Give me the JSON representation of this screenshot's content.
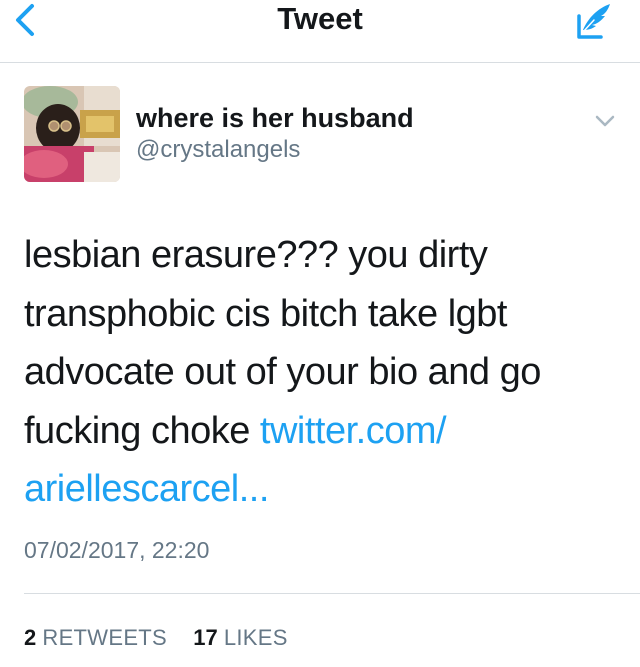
{
  "navbar": {
    "title": "Tweet",
    "back_icon": "chevron-left-icon",
    "compose_icon": "compose-feather-icon"
  },
  "tweet": {
    "author": {
      "display_name": "where is her husband",
      "handle": "@crystalangels"
    },
    "menu_icon": "chevron-down-icon",
    "text_lines": [
      {
        "text": "lesbian erasure??? you dirty",
        "link": ""
      },
      {
        "text": "transphobic cis bitch take lgbt",
        "link": ""
      },
      {
        "text": "advocate out of your bio and go",
        "link": ""
      },
      {
        "text": "fucking choke ",
        "link": "twitter.com/"
      },
      {
        "text": "",
        "link": "ariellescarcel..."
      }
    ],
    "timestamp": "07/02/2017, 22:20",
    "stats": {
      "retweets_count": "2",
      "retweets_label": "RETWEETS",
      "likes_count": "17",
      "likes_label": "LIKES"
    }
  },
  "colors": {
    "accent": "#1da1f2",
    "text_primary": "#14171a",
    "text_secondary": "#657786",
    "divider": "#d8dde1"
  }
}
